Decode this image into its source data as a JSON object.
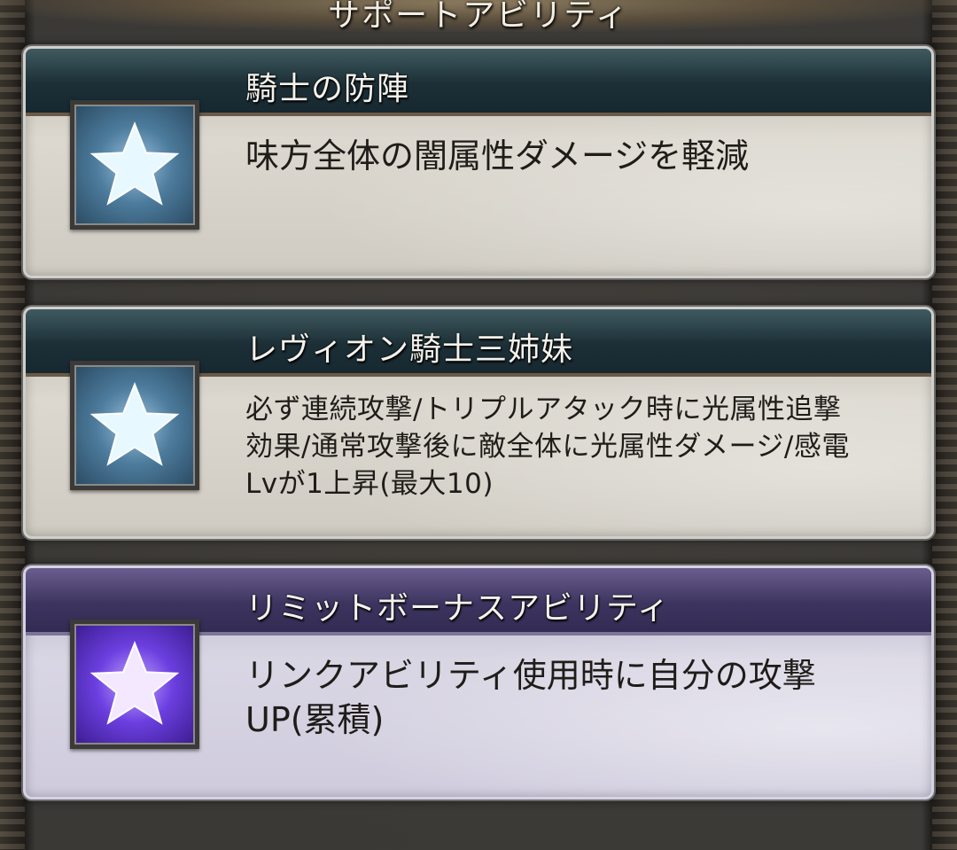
{
  "section": {
    "title": "サポートアビリティ"
  },
  "abilities": [
    {
      "name": "騎士の防陣",
      "description": "味方全体の闇属性ダメージを軽減",
      "icon": "star-icon",
      "color": "#7fb2d6"
    },
    {
      "name": "レヴィオン騎士三姉妹",
      "description": "必ず連続攻撃/トリプルアタック時に光属性追撃\n効果/通常攻撃後に敵全体に光属性ダメージ/感電\nLvが1上昇(最大10)",
      "icon": "star-icon",
      "color": "#7fb2d6"
    },
    {
      "name": "リミットボーナスアビリティ",
      "description": "リンクアビリティ使用時に自分の攻撃\nUP(累積)",
      "icon": "star-icon",
      "color": "#7a4cf0"
    }
  ]
}
